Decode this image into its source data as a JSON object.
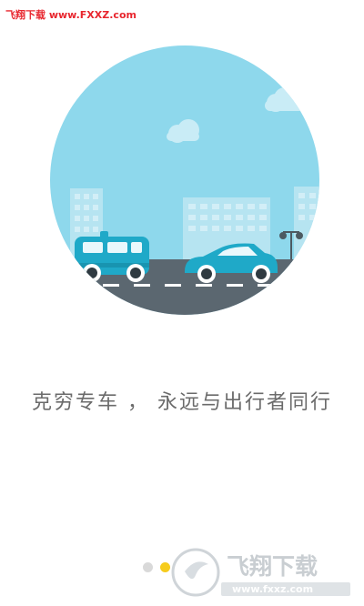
{
  "watermark_top": "飞翔下载 www.FXXZ.com",
  "slogan": "克穷专车 ， 永远与出行者同行",
  "pager": {
    "count": 4,
    "active_index": 1
  },
  "brand_logo": {
    "title": "飞翔下载",
    "url": "www.fxxz.com"
  },
  "colors": {
    "sky": "#8ed8ec",
    "road": "#5b6770",
    "car": "#1fa9c8",
    "accent_dot": "#f6cc1d",
    "watermark": "#e8262e"
  }
}
